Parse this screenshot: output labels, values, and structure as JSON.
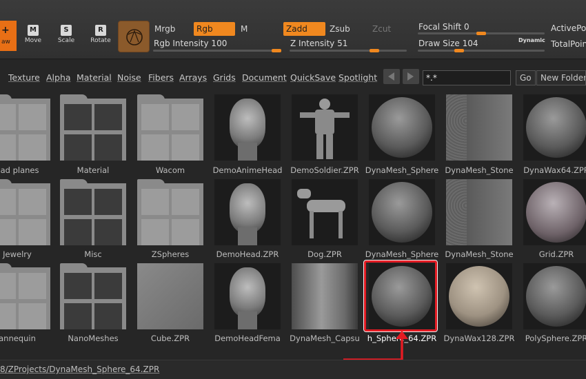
{
  "toolbar": {
    "draw_label": "aw",
    "move_label": "Move",
    "scale_label": "Scale",
    "rotate_label": "Rotate",
    "move_glyph": "M",
    "scale_glyph": "S",
    "rotate_glyph": "R",
    "mrgb": "Mrgb",
    "rgb": "Rgb",
    "m": "M",
    "rgb_intensity": "Rgb Intensity 100",
    "zadd": "Zadd",
    "zsub": "Zsub",
    "zcut": "Zcut",
    "z_intensity": "Z Intensity 51",
    "focal_shift": "Focal Shift 0",
    "draw_size": "Draw Size 104",
    "dynamic": "Dynamic",
    "active_points": "ActivePoi",
    "total_points": "TotalPoin",
    "accent_color": "#f0881f"
  },
  "lightbox": {
    "tabs": [
      "Texture",
      "Alpha",
      "Material",
      "Noise",
      "Fibers",
      "Arrays",
      "Grids",
      "Document",
      "QuickSave",
      "Spotlight"
    ],
    "search_value": "*.*",
    "go_label": "Go",
    "new_folder_label": "New Folder",
    "items": [
      {
        "label": "ead planes",
        "kind": "folder"
      },
      {
        "label": "Material",
        "kind": "folder"
      },
      {
        "label": "Wacom",
        "kind": "folder"
      },
      {
        "label": "DemoAnimeHead",
        "kind": "head"
      },
      {
        "label": "DemoSoldier.ZPR",
        "kind": "figure"
      },
      {
        "label": "DynaMesh_Sphere",
        "kind": "sphere"
      },
      {
        "label": "DynaMesh_Stone",
        "kind": "stone"
      },
      {
        "label": "DynaWax64.ZPR",
        "kind": "sphere"
      },
      {
        "label": "Jewelry",
        "kind": "folder"
      },
      {
        "label": "Misc",
        "kind": "folder"
      },
      {
        "label": "ZSpheres",
        "kind": "folder"
      },
      {
        "label": "DemoHead.ZPR",
        "kind": "head"
      },
      {
        "label": "Dog.ZPR",
        "kind": "dog"
      },
      {
        "label": "DynaMesh_Sphere",
        "kind": "sphere"
      },
      {
        "label": "DynaMesh_Stone",
        "kind": "stone"
      },
      {
        "label": "Grid.ZPR",
        "kind": "grid"
      },
      {
        "label": "annequin",
        "kind": "folder"
      },
      {
        "label": "NanoMeshes",
        "kind": "folder"
      },
      {
        "label": "Cube.ZPR",
        "kind": "cube"
      },
      {
        "label": "DemoHeadFema",
        "kind": "head"
      },
      {
        "label": "DynaMesh_Capsu",
        "kind": "capsule"
      },
      {
        "label": "h_Sphere_64.ZPR",
        "kind": "sphere"
      },
      {
        "label": "DynaWax128.ZPR",
        "kind": "wax"
      },
      {
        "label": "PolySphere.ZPR",
        "kind": "sphere"
      }
    ],
    "selected_index": 21,
    "highlight_color": "#e31b23"
  },
  "status": {
    "path": "8/ZProjects/DynaMesh_Sphere_64.ZPR"
  }
}
